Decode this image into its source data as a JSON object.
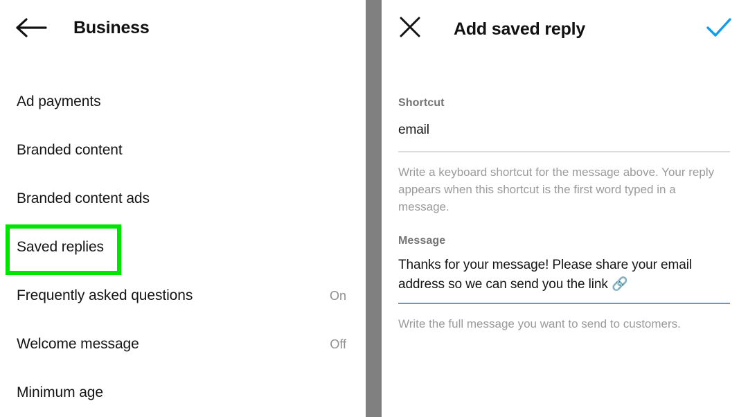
{
  "left_panel": {
    "header": {
      "back_icon": "arrow-left-icon",
      "title": "Business"
    },
    "menu_items": [
      {
        "label": "Ad payments",
        "status": ""
      },
      {
        "label": "Branded content",
        "status": ""
      },
      {
        "label": "Branded content ads",
        "status": ""
      },
      {
        "label": "Saved replies",
        "status": "",
        "highlighted": true
      },
      {
        "label": "Frequently asked questions",
        "status": "On"
      },
      {
        "label": "Welcome message",
        "status": "Off"
      },
      {
        "label": "Minimum age",
        "status": ""
      }
    ],
    "highlight_color": "#00e500"
  },
  "right_panel": {
    "header": {
      "close_icon": "close-x-icon",
      "title": "Add saved reply",
      "confirm_icon": "checkmark-icon",
      "confirm_color": "#0f9bf0"
    },
    "shortcut": {
      "label": "Shortcut",
      "value": "email",
      "placeholder": "Shortcut",
      "helper": "Write a keyboard shortcut for the message above. Your reply appears when this shortcut is the first word typed in a message.",
      "underline_color": "#dcdcdc"
    },
    "message": {
      "label": "Message",
      "value": "Thanks for your message! Please share your email address so we can send you the link 🔗",
      "placeholder": "Message",
      "helper": "Write the full message you want to send to customers.",
      "underline_color": "#5b9bd5"
    }
  },
  "divider": {
    "color": "#808080"
  }
}
